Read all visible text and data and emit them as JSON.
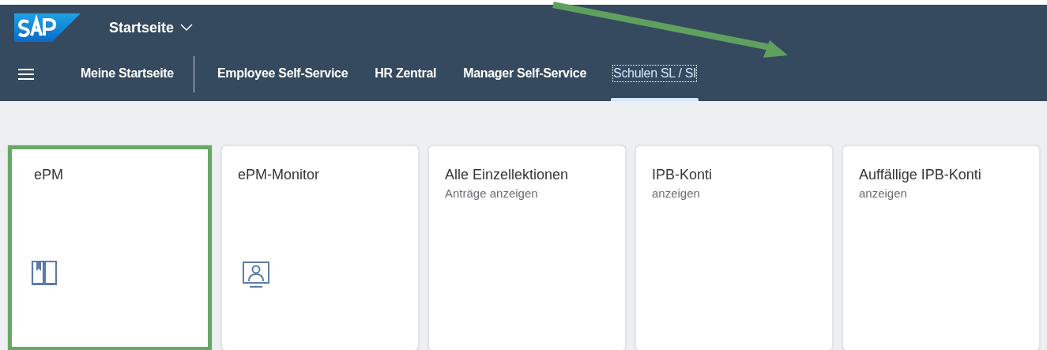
{
  "shell": {
    "title": "Startseite"
  },
  "tabs": [
    {
      "label": "Meine Startseite",
      "selected": false
    },
    {
      "label": "Employee Self-Service",
      "selected": false
    },
    {
      "label": "HR Zentral",
      "selected": false
    },
    {
      "label": "Manager Self-Service",
      "selected": false
    },
    {
      "label": "Schulen SL / SI",
      "selected": true
    }
  ],
  "tiles": [
    {
      "title": "ePM",
      "highlighted": true,
      "kind": "book"
    },
    {
      "title": "ePM-Monitor",
      "highlighted": false,
      "kind": "monitor"
    },
    {
      "title": "Alle Einzellektionen",
      "subtitle": "Anträge anzeigen",
      "highlighted": false
    },
    {
      "title": "IPB-Konti",
      "subtitle": "anzeigen",
      "highlighted": false
    },
    {
      "title": "Auffällige IPB-Konti",
      "subtitle": "anzeigen",
      "highlighted": false
    }
  ],
  "annotation": {
    "kind": "arrow"
  }
}
